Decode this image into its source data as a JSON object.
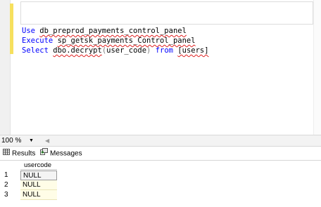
{
  "editor": {
    "lines": [
      {
        "keyword": "Use",
        "rest": "db_preprod_payments_control_panel"
      },
      {
        "keyword": "Execute",
        "rest": "sp_getsk_payments_Control_panel"
      },
      {
        "keyword": "Select",
        "func": "dbo.decrypt",
        "paren_open": "(",
        "arg": "user_code",
        "paren_close": ")",
        "from_kw": "from",
        "table": "[users]"
      }
    ]
  },
  "status": {
    "zoom": "100 %"
  },
  "results": {
    "tabs": [
      {
        "label": "Results",
        "icon": "grid-icon"
      },
      {
        "label": "Messages",
        "icon": "messages-icon"
      }
    ],
    "columns": [
      "usercode"
    ],
    "rows": [
      {
        "num": "1",
        "usercode": "NULL"
      },
      {
        "num": "2",
        "usercode": "NULL"
      },
      {
        "num": "3",
        "usercode": "NULL"
      }
    ]
  },
  "colors": {
    "keyword": "#0000ff",
    "operator": "#808080",
    "change_bar": "#f6e05e",
    "cell_bg": "#fffde7"
  }
}
